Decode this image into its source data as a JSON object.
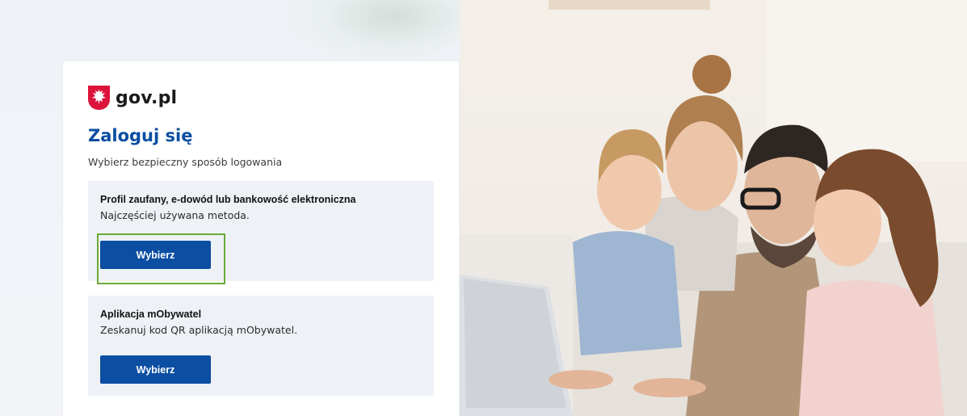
{
  "brand": {
    "logo_text": "gov.pl",
    "emblem_icon": "polish-eagle-emblem-icon",
    "emblem_color": "#dc143c"
  },
  "login": {
    "title": "Zaloguj się",
    "subtitle": "Wybierz bezpieczny sposób logowania",
    "options": [
      {
        "title": "Profil zaufany, e-dowód lub bankowość elektroniczna",
        "description": "Najczęściej używana metoda.",
        "button_label": "Wybierz"
      },
      {
        "title": "Aplikacja mObywatel",
        "description": "Zeskanuj kod QR aplikacją mObywatel.",
        "button_label": "Wybierz"
      }
    ]
  },
  "colors": {
    "accent": "#0b4ea2",
    "highlight": "#6aaa3a",
    "option_bg": "#eef2f7"
  },
  "photo": {
    "subject": "family-using-laptop-photo"
  }
}
